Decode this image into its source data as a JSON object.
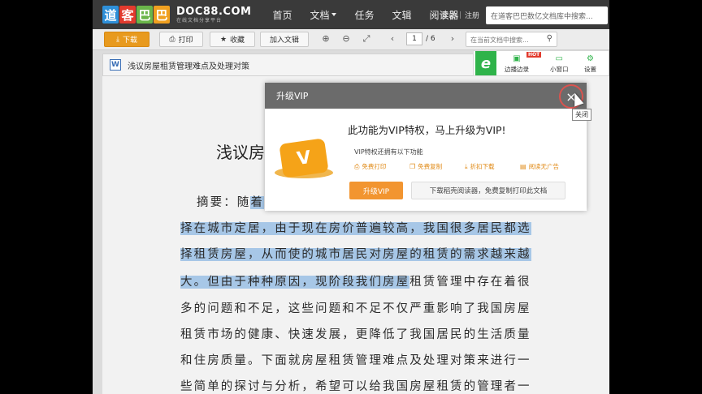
{
  "logo": {
    "chars": [
      "道",
      "客",
      "巴",
      "巴"
    ],
    "name": "DOC88.COM",
    "tagline": "在线文档分享平台",
    "colors": [
      "#2e8fd8",
      "#e23b2e",
      "#6ab54a",
      "#f0a020"
    ]
  },
  "nav": {
    "items": [
      "首页",
      "文档",
      "任务",
      "文辑",
      "阅读器"
    ],
    "login": "登录",
    "separator": "|",
    "register": "注册",
    "search_placeholder": "在道客巴巴数亿文档库中搜索..."
  },
  "toolbar": {
    "download": "下载",
    "print": "打印",
    "favorite": "收藏",
    "add_to_collection": "加入文辑",
    "page_current": "1",
    "page_total": "/ 6",
    "prev": "‹",
    "next": "›",
    "doc_search_placeholder": "在当前文档中搜索..."
  },
  "document": {
    "title": "浅议房屋租赁管理难点及处理对策",
    "heading_visible": "浅议房",
    "abstract_label": "摘要：随",
    "abstract_highlight_start": "着",
    "lines": [
      "择在城市定居，由于现在房价普遍较高，我国很多居民都选",
      "择租赁房屋，从而使的城市居民对房屋的租赁的需求越来越",
      "大。但由于种种原因，现阶段我们房屋",
      "多的问题和不足，这些问题和不足不仅严重影响了我国房屋",
      "租赁市场的健康、快速发展，更降低了我国居民的生活质量",
      "和住房质量。下面就房屋租赁管理难点及处理对策来进行一",
      "些简单的探讨与分析，希望可以给我国房屋租赁的管理者一"
    ],
    "line3_rest": "租赁管理中存在着很"
  },
  "side_panel": {
    "logo": "e",
    "items": [
      "边播边录",
      "小窗口",
      "设置"
    ],
    "hot_badge": "HOT"
  },
  "modal": {
    "header": "升级VIP",
    "close_icon": "×",
    "close_tooltip": "关闭",
    "headline": "此功能为VIP特权，马上升级为VIP!",
    "subline": "VIP特权还拥有以下功能",
    "features": [
      "免费打印",
      "免费复制",
      "折扣下载",
      "阅读无广告"
    ],
    "upgrade_button": "升级VIP",
    "reader_button": "下载稻壳阅读器，免费复制打印此文档",
    "vip_glyph": "V"
  }
}
